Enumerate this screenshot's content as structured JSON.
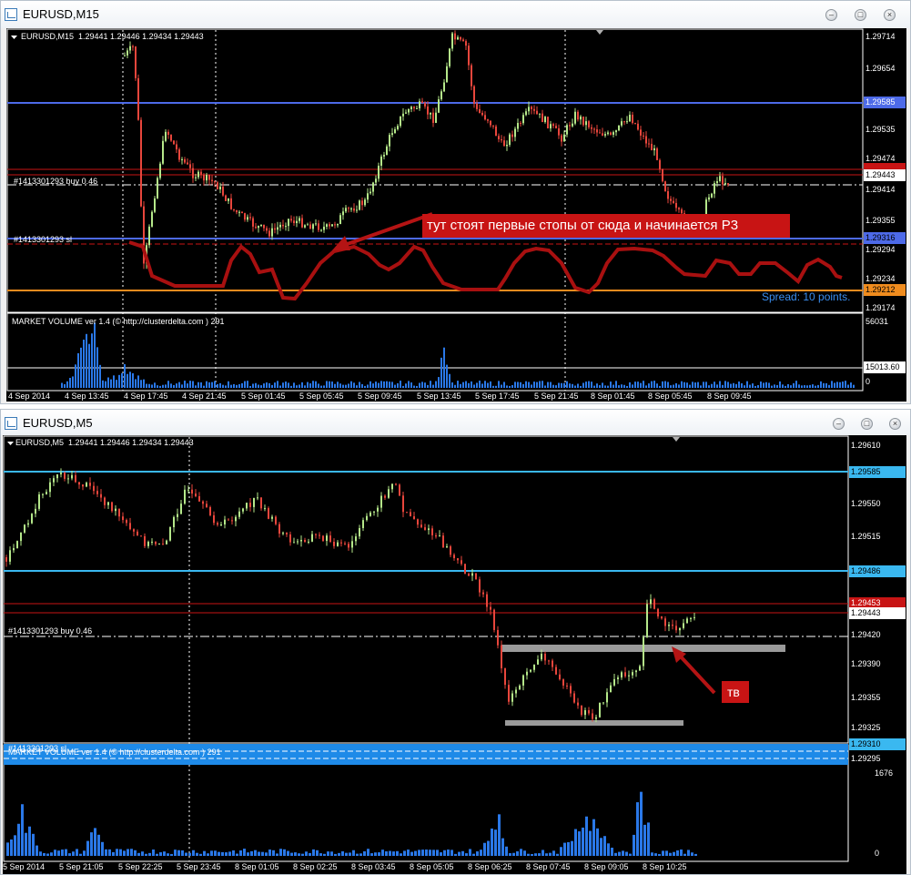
{
  "windows": [
    {
      "title": "EURUSD,M15",
      "chart_header": "EURUSD,M15  1.29441 1.29446 1.29434 1.29443",
      "order_label": "#1413301293 buy 0.46",
      "sl_label": "#1413301293 sl",
      "annotation": "тут стоят первые стопы от сюда и начинается Р3",
      "spread": "Spread: 10 points.",
      "price_axis": [
        "1.29714",
        "1.29654",
        "1.29585",
        "1.29535",
        "1.29474",
        "1.29443",
        "1.29414",
        "1.29355",
        "1.29316",
        "1.29294",
        "1.29234",
        "1.29212",
        "1.29174"
      ],
      "highlighted_prices": {
        "blue_top": "1.29585",
        "red": "1.29474",
        "white": "1.29443",
        "blue_sl": "1.29316",
        "orange": "1.29212"
      },
      "volume_label": "MARKET VOLUME ver 1.4 (© http://clusterdelta.com ) 291",
      "volume_axis": [
        "56031",
        "15013.60",
        "0"
      ],
      "time_axis": [
        "4 Sep 2014",
        "4 Sep 13:45",
        "4 Sep 17:45",
        "4 Sep 21:45",
        "5 Sep 01:45",
        "5 Sep 05:45",
        "5 Sep 09:45",
        "5 Sep 13:45",
        "5 Sep 17:45",
        "5 Sep 21:45",
        "8 Sep 01:45",
        "8 Sep 05:45",
        "8 Sep 09:45"
      ]
    },
    {
      "title": "EURUSD,M5",
      "chart_header": "EURUSD,M5  1.29441 1.29446 1.29434 1.29443",
      "order_label": "#1413301293 buy 0.46",
      "sl_label": "#1413301293 sl",
      "annotation": "тв",
      "price_axis": [
        "1.29610",
        "1.29585",
        "1.29550",
        "1.29515",
        "1.29486",
        "1.29453",
        "1.29443",
        "1.29420",
        "1.29390",
        "1.29355",
        "1.29325",
        "1.29310",
        "1.29295"
      ],
      "volume_label": "MARKET VOLUME ver 1.4 (© http://clusterdelta.com ) 291",
      "volume_axis": [
        "1676",
        "0"
      ],
      "time_axis": [
        "5 Sep 2014",
        "5 Sep 21:05",
        "5 Sep 22:25",
        "5 Sep 23:45",
        "8 Sep 01:05",
        "8 Sep 02:25",
        "8 Sep 03:45",
        "8 Sep 05:05",
        "8 Sep 06:25",
        "8 Sep 07:45",
        "8 Sep 09:05",
        "8 Sep 10:25"
      ]
    }
  ],
  "icons": [
    "chart-window-icon",
    "minimize-icon",
    "maximize-icon",
    "close-icon",
    "dropdown-triangle-icon"
  ],
  "colors": {
    "bull": "#b5e88a",
    "bear": "#e8463c",
    "blue_line": "#4d6ae8",
    "cyan_line": "#3ab8f0",
    "red_line": "#c81414",
    "orange_line": "#f08c1e",
    "annotation": "#b41414",
    "volume": "#2a78e8"
  }
}
